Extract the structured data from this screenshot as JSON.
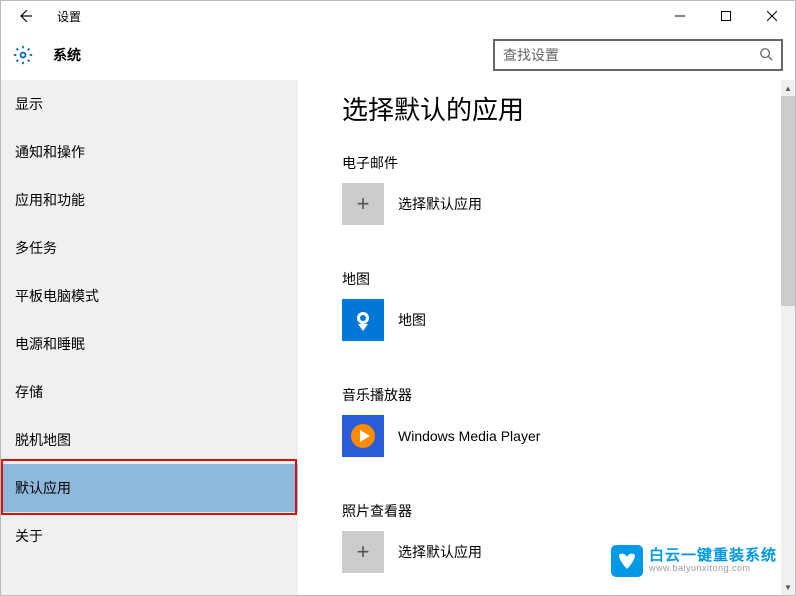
{
  "titlebar": {
    "app_title": "设置"
  },
  "header": {
    "heading": "系统",
    "search": {
      "placeholder": "查找设置"
    }
  },
  "sidebar": {
    "items": [
      {
        "label": "显示"
      },
      {
        "label": "通知和操作"
      },
      {
        "label": "应用和功能"
      },
      {
        "label": "多任务"
      },
      {
        "label": "平板电脑模式"
      },
      {
        "label": "电源和睡眠"
      },
      {
        "label": "存储"
      },
      {
        "label": "脱机地图"
      },
      {
        "label": "默认应用"
      },
      {
        "label": "关于"
      }
    ]
  },
  "main": {
    "title": "选择默认的应用",
    "categories": [
      {
        "label": "电子邮件",
        "app_name": "选择默认应用",
        "tile": "plus"
      },
      {
        "label": "地图",
        "app_name": "地图",
        "tile": "maps"
      },
      {
        "label": "音乐播放器",
        "app_name": "Windows Media Player",
        "tile": "wmp"
      },
      {
        "label": "照片查看器",
        "app_name": "选择默认应用",
        "tile": "plus"
      }
    ]
  },
  "watermark": {
    "cn": "白云一键重装系统",
    "en": "www.baiyunxitong.com"
  }
}
